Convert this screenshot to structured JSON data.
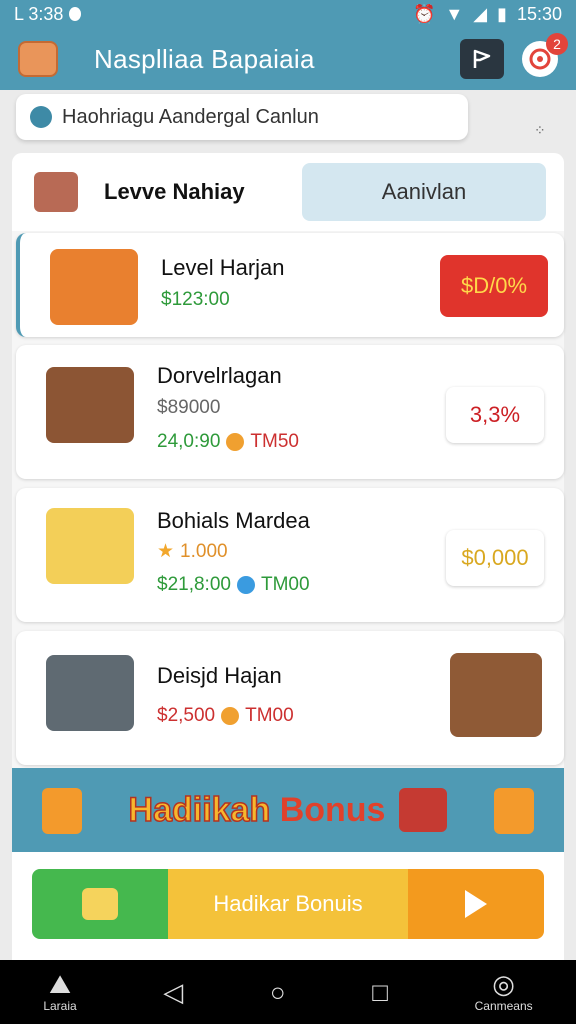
{
  "status_bar": {
    "left": "L 3:38",
    "time": "15:30"
  },
  "app": {
    "title": "Nasplliaa Bapaiaia",
    "notification_count": "2"
  },
  "search": {
    "text": "Haohriagu Aandergal Canlun"
  },
  "tabs": {
    "active": "Levve Nahiay",
    "other": "Aanivlan"
  },
  "items": [
    {
      "title": "Level Harjan",
      "price": "$123:00",
      "badge": "$D/0%"
    },
    {
      "title": "Dorvelrlagan",
      "old_price": "$89000",
      "price": "24,0:90",
      "tag": "TM50",
      "badge": "3,3%"
    },
    {
      "title": "Bohials Mardea",
      "rating": "1.000",
      "price": "$21,8:00",
      "tag": "TM00",
      "badge": "$0,000"
    },
    {
      "title": "Deisjd Hajan",
      "price": "$2,500",
      "tag": "TM00"
    }
  ],
  "banner": {
    "word1": "Hadiikah",
    "word2": "Bonus"
  },
  "cta": {
    "label": "Hadikar Bonuis"
  },
  "nav": {
    "left_label": "Laraia",
    "right_label": "Canmeans"
  },
  "colors": {
    "primary": "#4f9ab4",
    "accent_red": "#e0342c",
    "green": "#2e9a3a"
  }
}
